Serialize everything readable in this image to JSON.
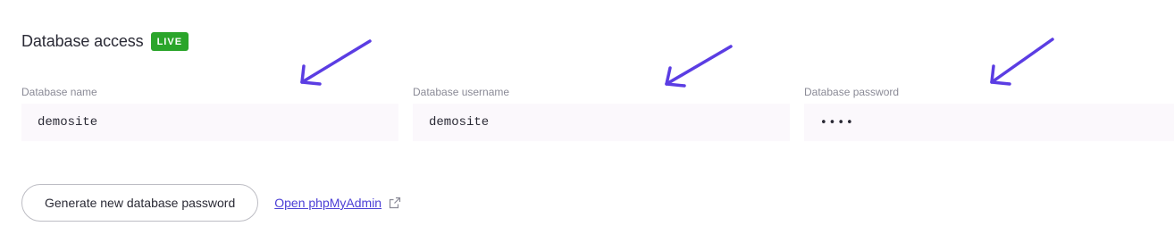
{
  "section": {
    "title": "Database access",
    "badge": "LIVE"
  },
  "fields": [
    {
      "label": "Database name",
      "value": "demosite"
    },
    {
      "label": "Database username",
      "value": "demosite"
    },
    {
      "label": "Database password",
      "value": "••••"
    }
  ],
  "actions": {
    "generate_label": "Generate new database password",
    "phpmyadmin_label": "Open phpMyAdmin"
  },
  "icons": {
    "external_link": "external-link-icon",
    "annotation_arrow": "arrow-icon"
  },
  "colors": {
    "badge": "#2aa52a",
    "link": "#4b3fd6",
    "annotation_arrow": "#5b3de3",
    "field_background": "#fbf8fc"
  }
}
